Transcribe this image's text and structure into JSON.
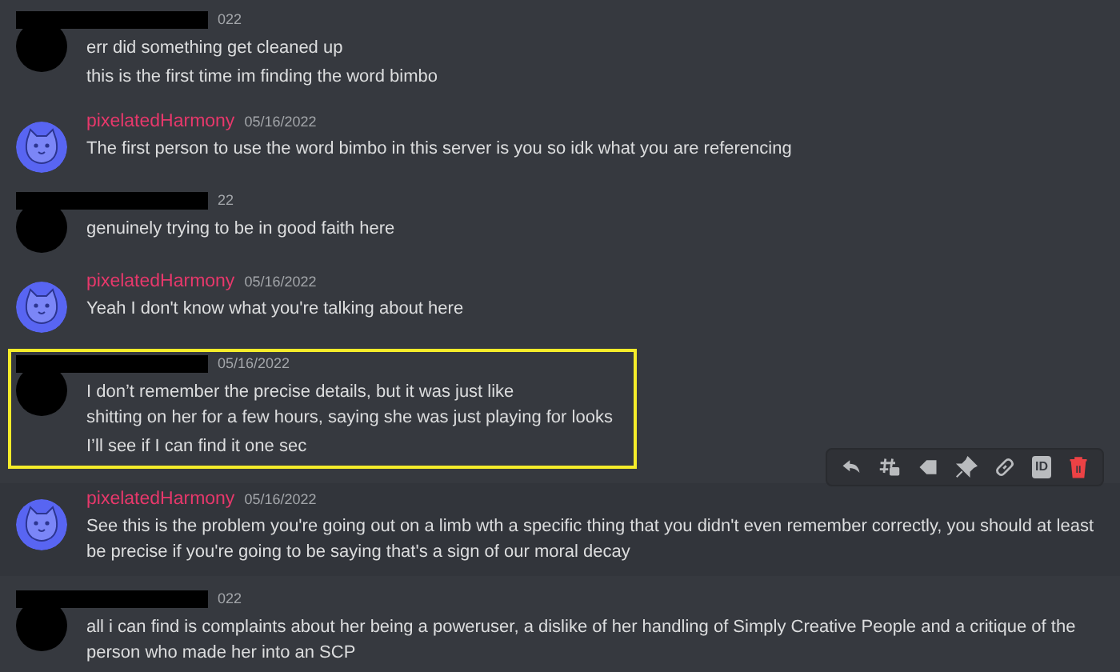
{
  "messages": [
    {
      "kind": "redacted",
      "timestamp": "022",
      "lines": [
        "err did something get cleaned up",
        "this is the first time im finding the word bimbo"
      ],
      "highlighted": false,
      "hovered": false
    },
    {
      "kind": "named",
      "author": "pixelatedHarmony",
      "timestamp": "05/16/2022",
      "lines": [
        "The first person to use the word bimbo in this server is you so idk what you are referencing"
      ],
      "highlighted": false,
      "hovered": false
    },
    {
      "kind": "redacted",
      "timestamp": "22",
      "lines": [
        "genuinely trying to be in good faith here"
      ],
      "highlighted": false,
      "hovered": false
    },
    {
      "kind": "named",
      "author": "pixelatedHarmony",
      "timestamp": "05/16/2022",
      "lines": [
        "Yeah I don't know what you're talking about here"
      ],
      "highlighted": false,
      "hovered": false
    },
    {
      "kind": "redacted",
      "timestamp": "05/16/2022",
      "lines": [
        "I don’t remember the precise details, but it was just like\nshitting on her for a few hours, saying she was just playing for looks",
        "I’ll see if I can find it one sec"
      ],
      "highlighted": true,
      "hovered": false
    },
    {
      "kind": "named",
      "author": "pixelatedHarmony",
      "timestamp": "05/16/2022",
      "lines": [
        "See this is the problem you're going out on a limb wth a specific thing that you didn't even remember correctly, you should at least be precise if you're going to be saying that's a sign of our moral decay"
      ],
      "highlighted": false,
      "hovered": true
    },
    {
      "kind": "redacted",
      "timestamp": "022",
      "lines": [
        "all i can find is complaints about her being a poweruser, a dislike of her handling of Simply Creative People and a critique of the person who made her into an SCP"
      ],
      "highlighted": false,
      "hovered": false
    }
  ],
  "toolbar": {
    "id_label": "ID"
  }
}
